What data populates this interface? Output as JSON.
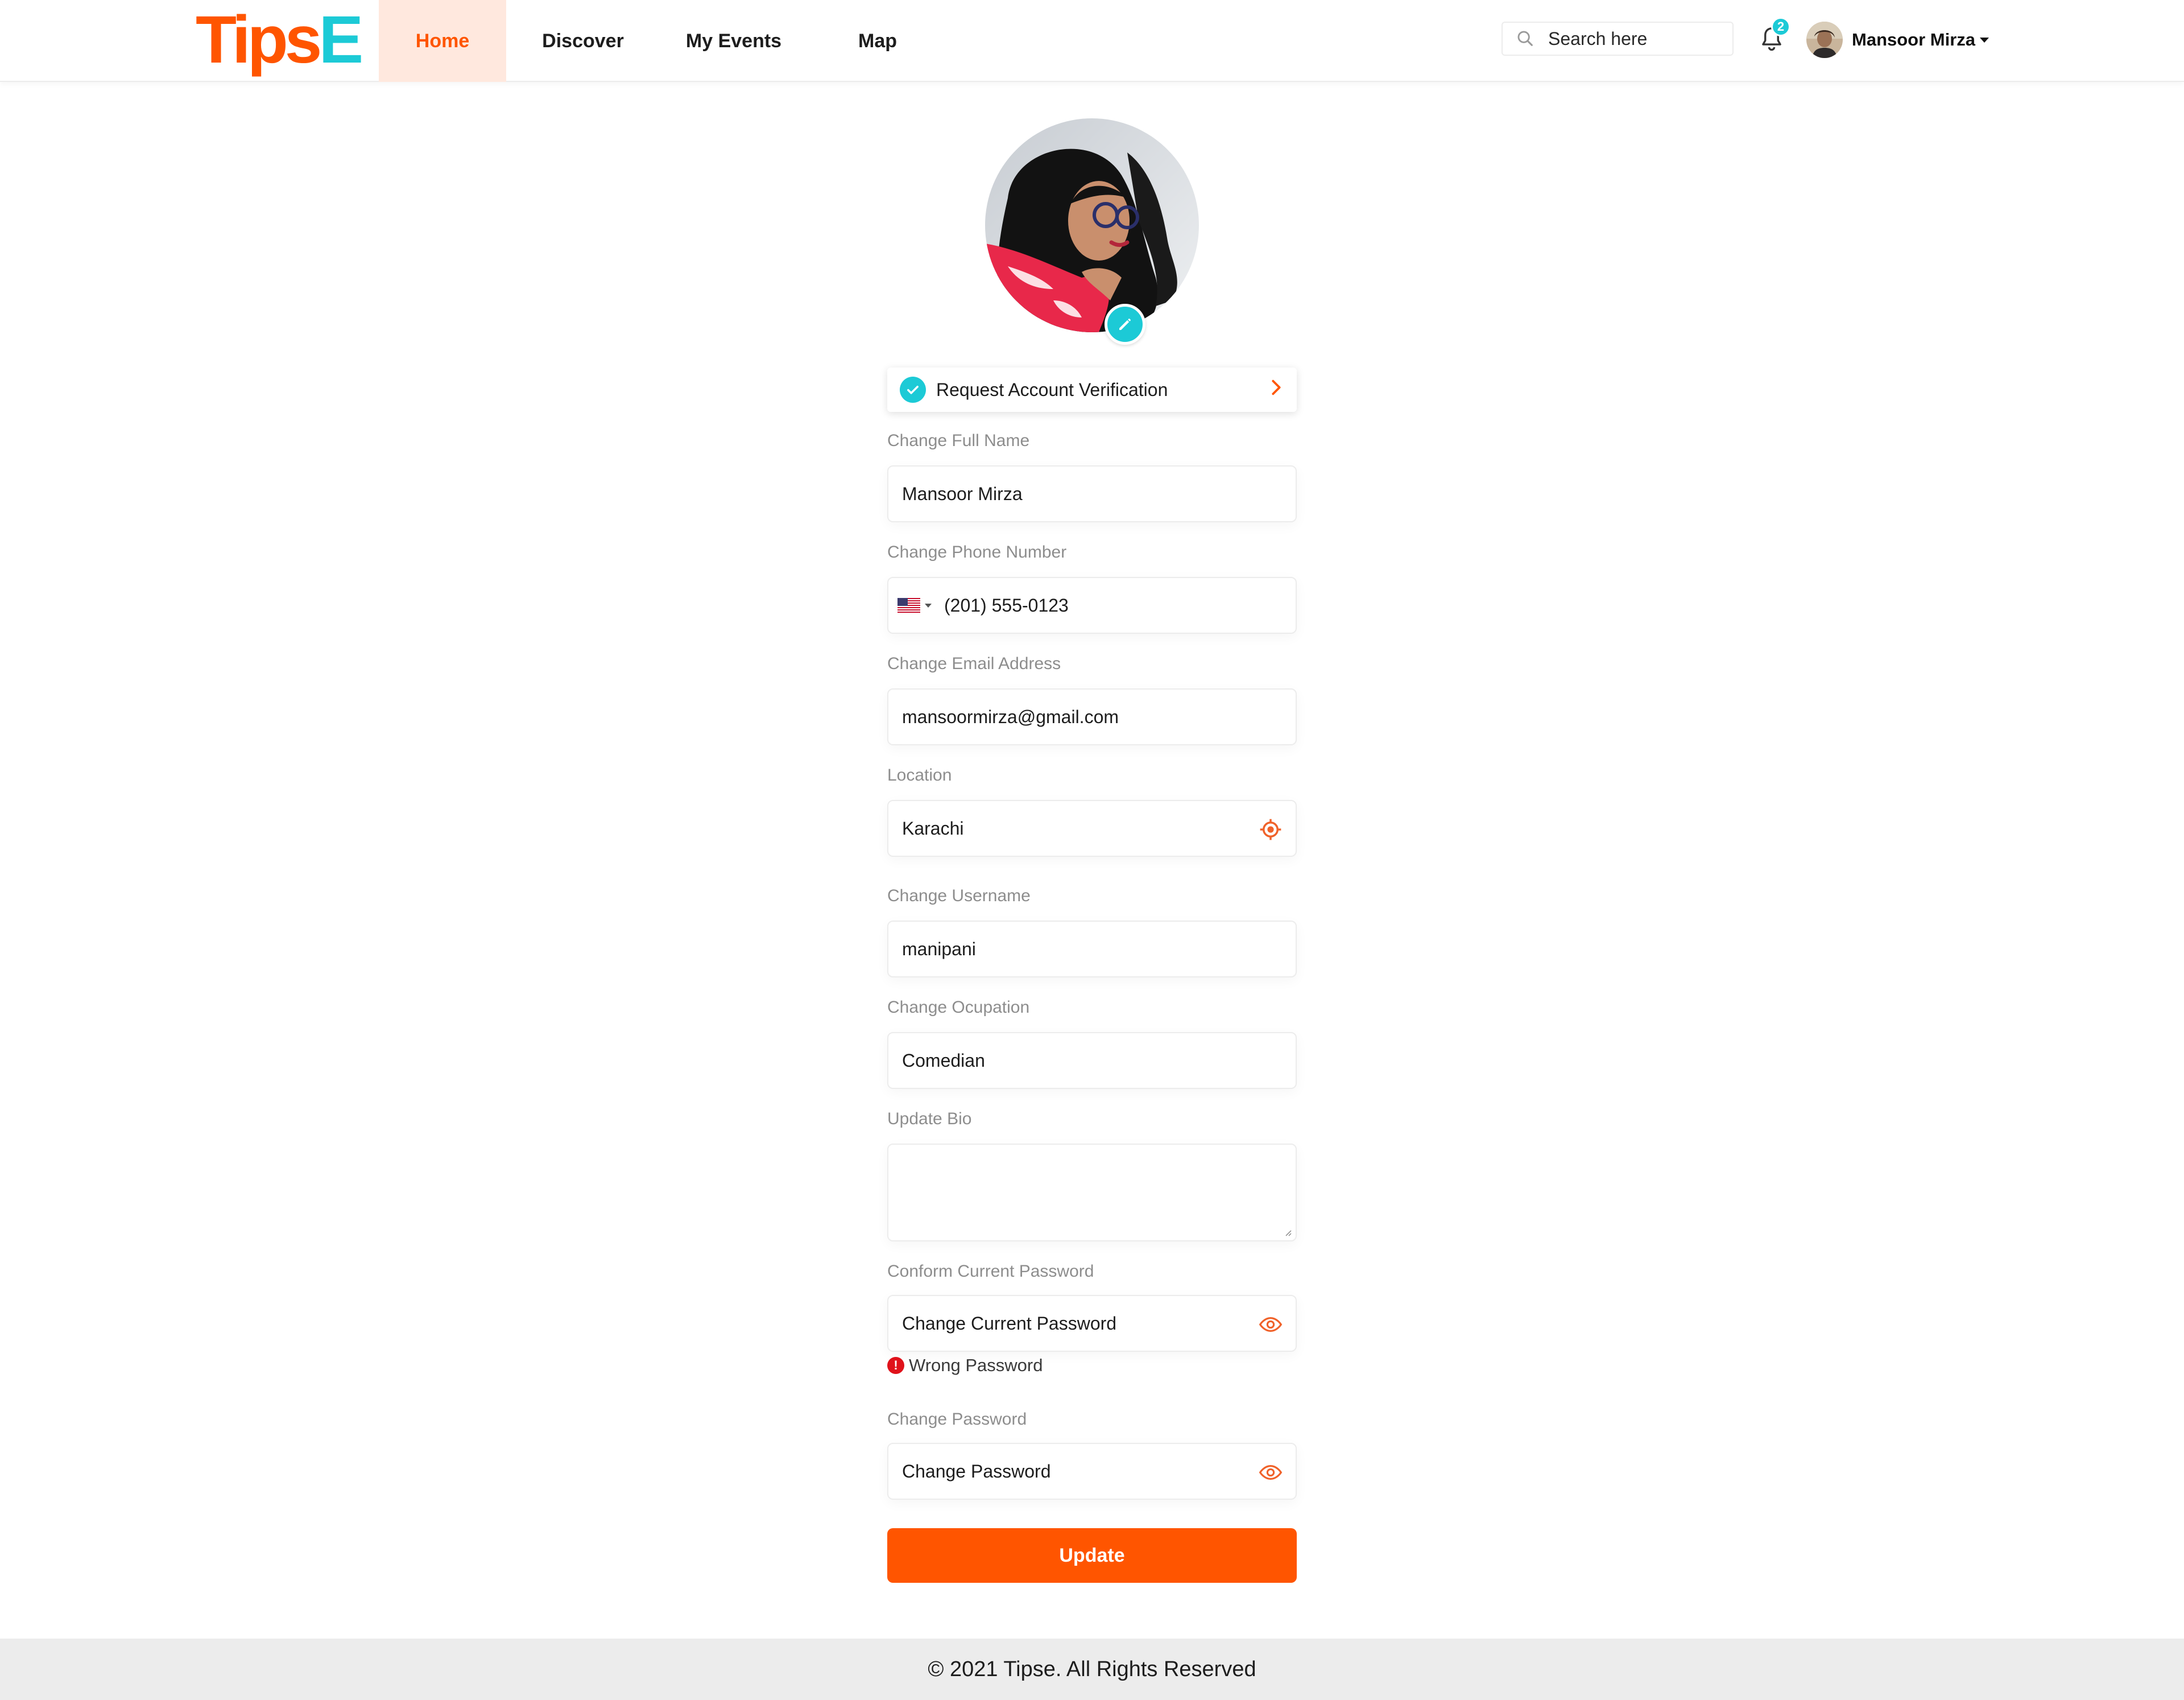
{
  "brand": {
    "logo_text_1": "Tips",
    "logo_text_2": "E",
    "accent_color": "#ff5500",
    "secondary_color": "#1ccad6"
  },
  "nav": {
    "items": [
      {
        "label": "Home",
        "active": true
      },
      {
        "label": "Discover",
        "active": false
      },
      {
        "label": "My Events",
        "active": false
      },
      {
        "label": "Map",
        "active": false
      }
    ]
  },
  "header": {
    "search_placeholder": "Search here",
    "notification_count": "2",
    "user_name": "Mansoor Mirza"
  },
  "profile": {
    "verify_label": "Request Account Verification",
    "fields": {
      "full_name": {
        "label": "Change Full Name",
        "value": "Mansoor Mirza"
      },
      "phone": {
        "label": "Change Phone Number",
        "value": "(201) 555-0123",
        "country": "US"
      },
      "email": {
        "label": "Change Email Address",
        "value": "mansoormirza@gmail.com"
      },
      "location": {
        "label": "Location",
        "value": "Karachi"
      },
      "username": {
        "label": "Change Username",
        "value": "manipani"
      },
      "occupation": {
        "label": "Change Ocupation",
        "value": "Comedian"
      },
      "bio": {
        "label": "Update Bio",
        "value": ""
      },
      "current_password": {
        "label": "Conform Current Password",
        "placeholder": "Change Current Password"
      },
      "new_password": {
        "label": "Change Password",
        "placeholder": "Change Password"
      }
    },
    "error_text": "Wrong Password",
    "update_label": "Update"
  },
  "footer": {
    "text": "© 2021 Tipse. All Rights Reserved"
  }
}
